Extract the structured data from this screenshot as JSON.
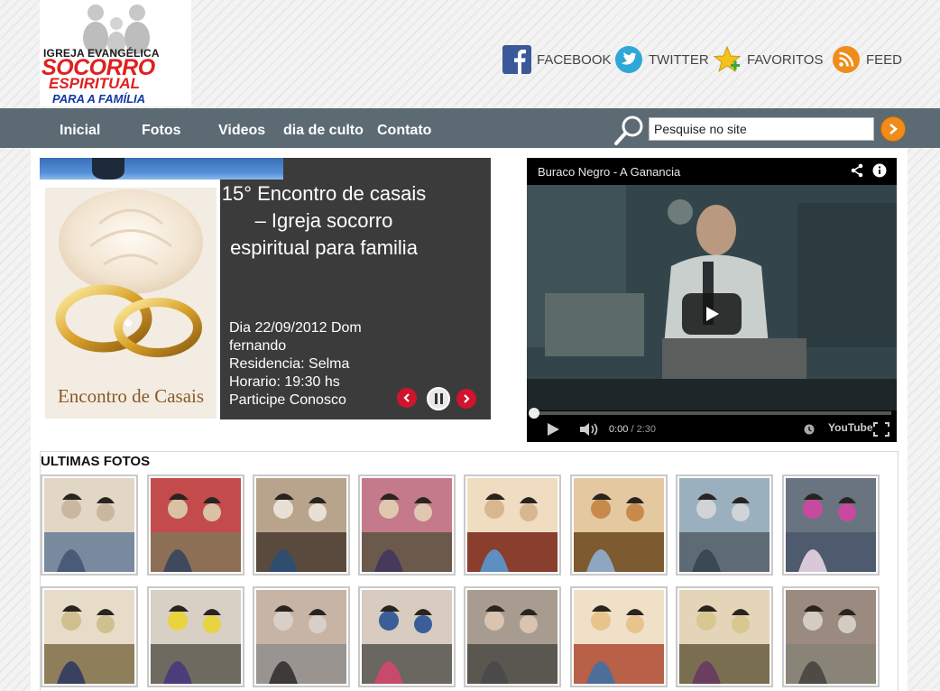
{
  "logo": {
    "line1": "IGREJA EVANGÉLICA",
    "line2": "SOCORRO",
    "line3": "ESPIRITUAL",
    "line4": "PARA A FAMÍLIA"
  },
  "social": [
    {
      "label": "FACEBOOK",
      "icon": "facebook-icon",
      "color": "#3b5998"
    },
    {
      "label": "TWITTER",
      "icon": "twitter-icon",
      "color": "#2fa8d8"
    },
    {
      "label": "FAVORITOS",
      "icon": "star-icon",
      "color": "#f4c21a"
    },
    {
      "label": "FEED",
      "icon": "rss-icon",
      "color": "#f08c1a"
    }
  ],
  "nav": {
    "items": [
      "Inicial",
      "Fotos",
      "Videos",
      "dia de culto",
      "Contato"
    ]
  },
  "search": {
    "value": "Pesquise no site",
    "button_icon": "chevron-right-icon"
  },
  "slider": {
    "title": "15° Encontro de casais – Igreja socorro espiritual para familia",
    "image_caption": "Encontro de Casais",
    "desc_lines": [
      "Dia 22/09/2012 Dom fernando",
      "Residencia: Selma",
      "Horario: 19:30 hs",
      "Participe Conosco"
    ]
  },
  "video": {
    "title": "Buraco Negro - A Ganancia",
    "time_current": "0:00",
    "time_total": "2:30",
    "brand": "YouTube"
  },
  "photos": {
    "heading": "ULTIMAS FOTOS"
  },
  "colors": {
    "nav_bg": "#5c6a73",
    "accent_orange": "#f08c1a",
    "slider_bg": "#3b3b3b",
    "control_red": "#d0142c"
  }
}
